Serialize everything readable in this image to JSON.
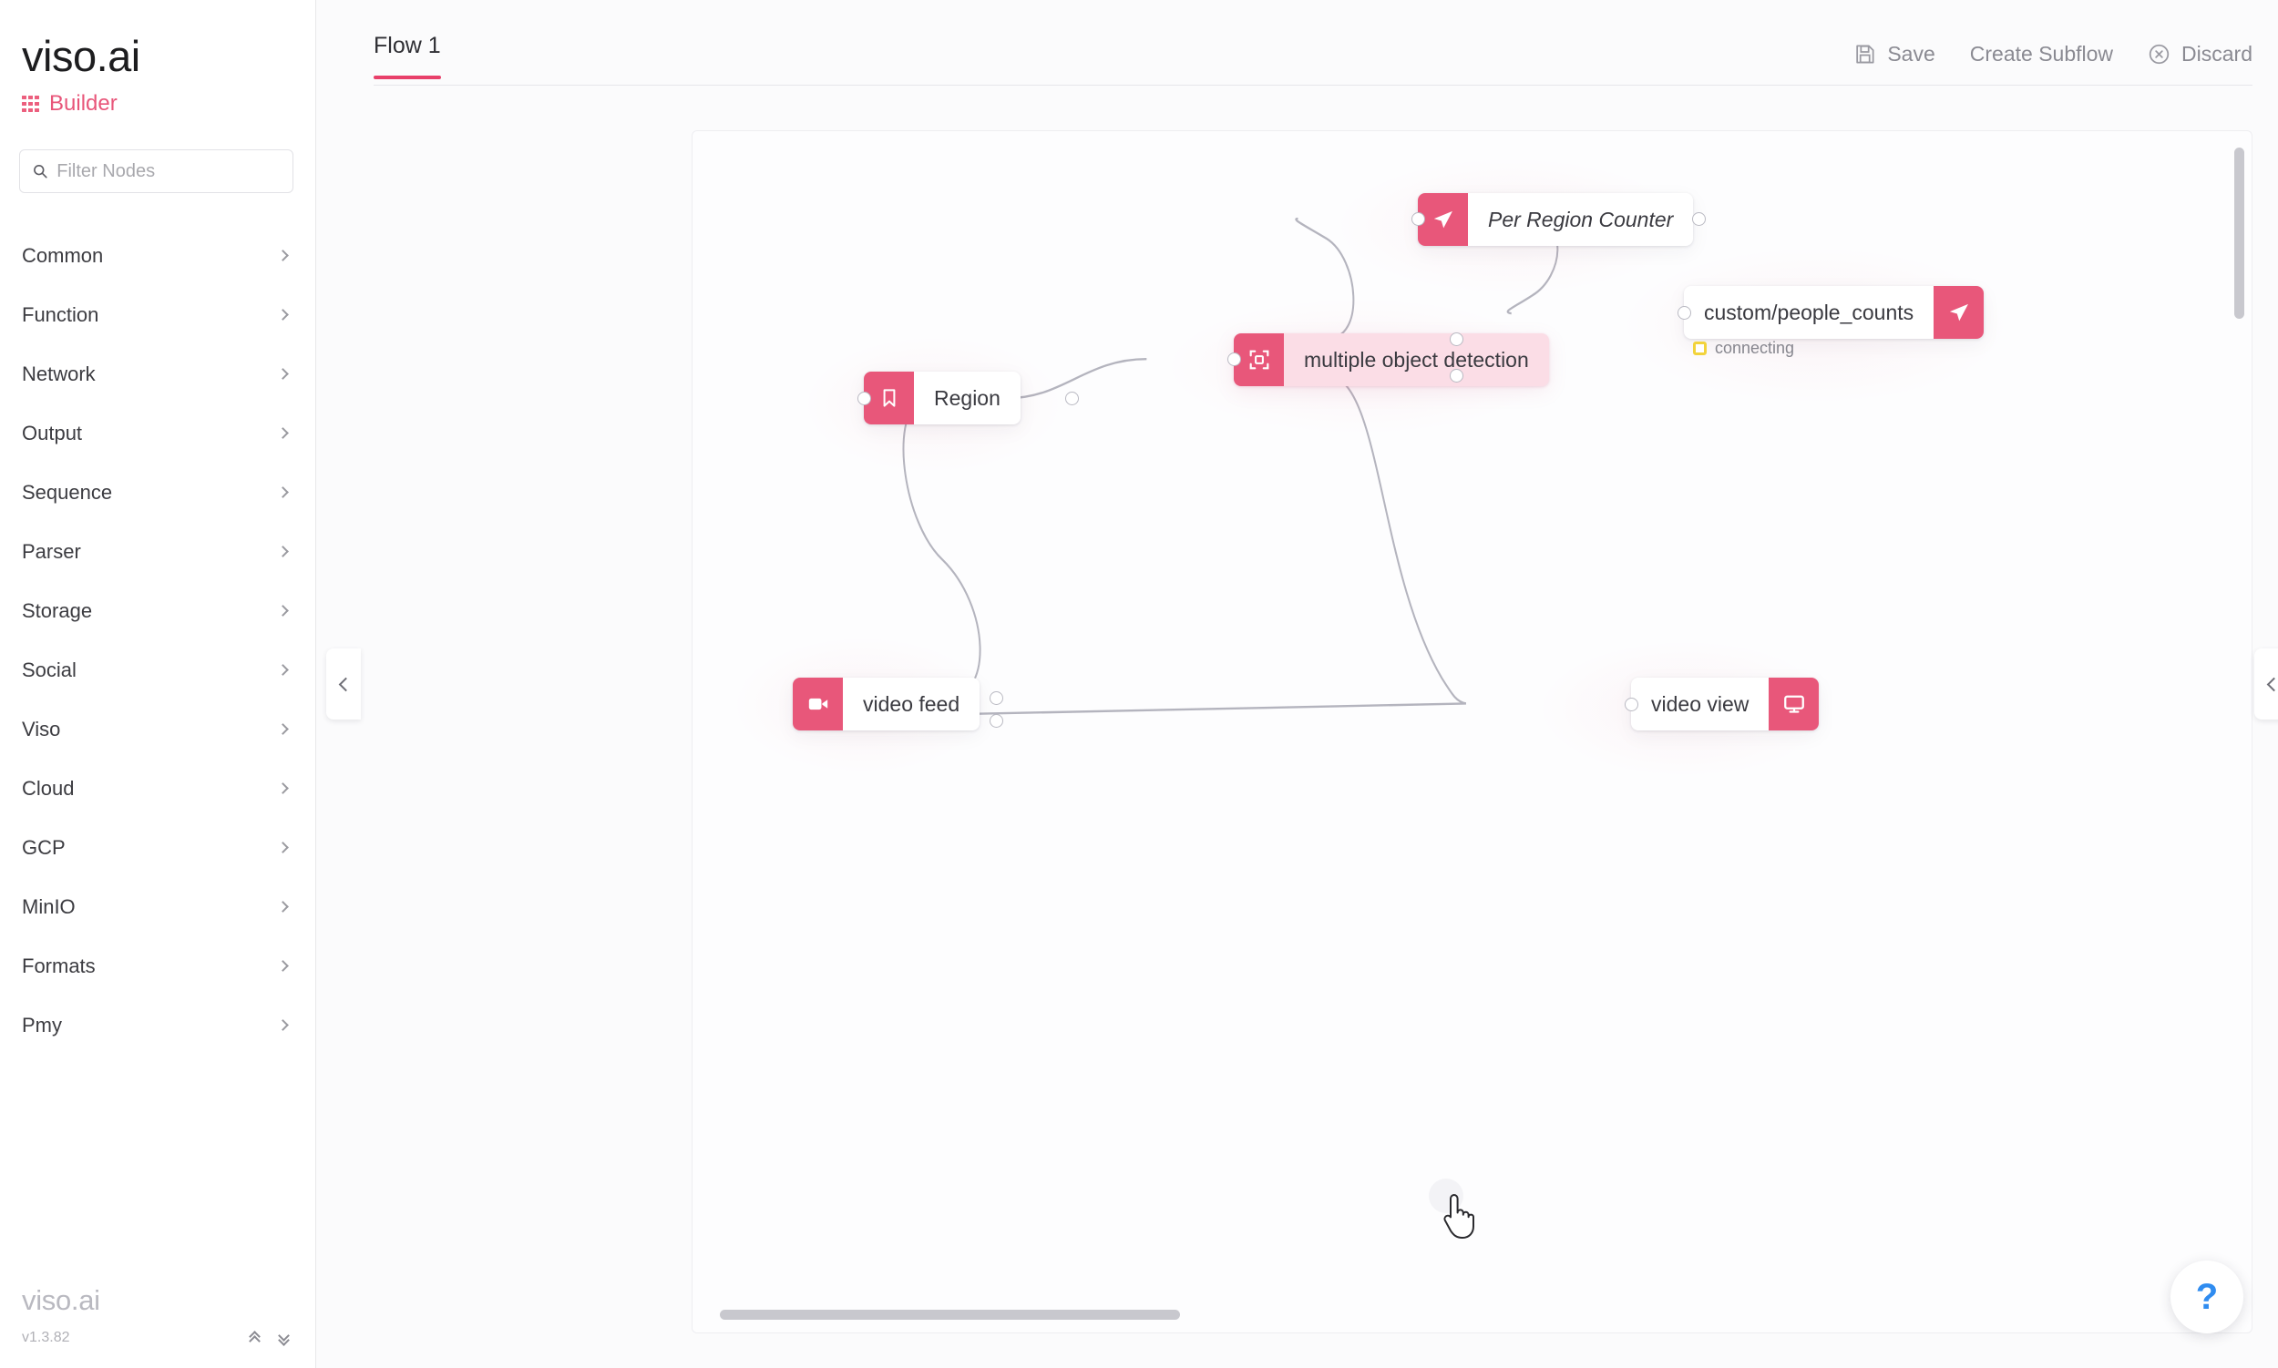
{
  "sidebar": {
    "logo": "viso.ai",
    "app_name": "Builder",
    "app_icon": "grid-icon",
    "search": {
      "placeholder": "Filter Nodes",
      "value": "",
      "icon": "search-icon"
    },
    "items": [
      {
        "label": "Common"
      },
      {
        "label": "Function"
      },
      {
        "label": "Network"
      },
      {
        "label": "Output"
      },
      {
        "label": "Sequence"
      },
      {
        "label": "Parser"
      },
      {
        "label": "Storage"
      },
      {
        "label": "Social"
      },
      {
        "label": "Viso"
      },
      {
        "label": "Cloud"
      },
      {
        "label": "GCP"
      },
      {
        "label": "MinIO"
      },
      {
        "label": "Formats"
      },
      {
        "label": "Pmy"
      }
    ],
    "footer": {
      "logo": "viso.ai",
      "version": "v1.3.82",
      "collapse_all_icon": "double-chevron-up-icon",
      "expand_all_icon": "double-chevron-down-icon"
    }
  },
  "topbar": {
    "tabs": [
      {
        "label": "Flow 1",
        "active": true
      }
    ],
    "actions": [
      {
        "label": "Save",
        "icon": "save-floppy-icon"
      },
      {
        "label": "Create Subflow",
        "icon": ""
      },
      {
        "label": "Discard",
        "icon": "circle-x-icon"
      }
    ]
  },
  "canvas": {
    "nodes": [
      {
        "id": "video-feed",
        "label": "video feed",
        "icon": "video-camera-icon",
        "icon_side": "left",
        "selected": false,
        "italic": false
      },
      {
        "id": "region",
        "label": "Region",
        "icon": "bookmark-icon",
        "icon_side": "left",
        "selected": false,
        "italic": false
      },
      {
        "id": "multiple-object-detection",
        "label": "multiple object detection",
        "icon": "object-detection-icon",
        "icon_side": "left",
        "selected": true,
        "italic": false
      },
      {
        "id": "per-region-counter",
        "label": "Per Region Counter",
        "icon": "send-icon",
        "icon_side": "left",
        "selected": false,
        "italic": true
      },
      {
        "id": "custom-people-counts",
        "label": "custom/people_counts",
        "icon": "send-icon",
        "icon_side": "right",
        "selected": false,
        "italic": false,
        "status": "connecting",
        "status_color": "#f2d33c"
      },
      {
        "id": "video-view",
        "label": "video view",
        "icon": "monitor-icon",
        "icon_side": "right",
        "selected": false,
        "italic": false
      }
    ],
    "help_button": {
      "label": "?",
      "color": "#2f8cf0"
    },
    "left_handle_icon": "chevron-left-icon",
    "right_handle_icon": "chevron-left-icon"
  },
  "colors": {
    "accent": "#e8406a",
    "node_icon": "#e8577a",
    "selected_node_bg": "#fbdde6",
    "status_connecting": "#f2d33c",
    "help_blue": "#2f8cf0"
  }
}
